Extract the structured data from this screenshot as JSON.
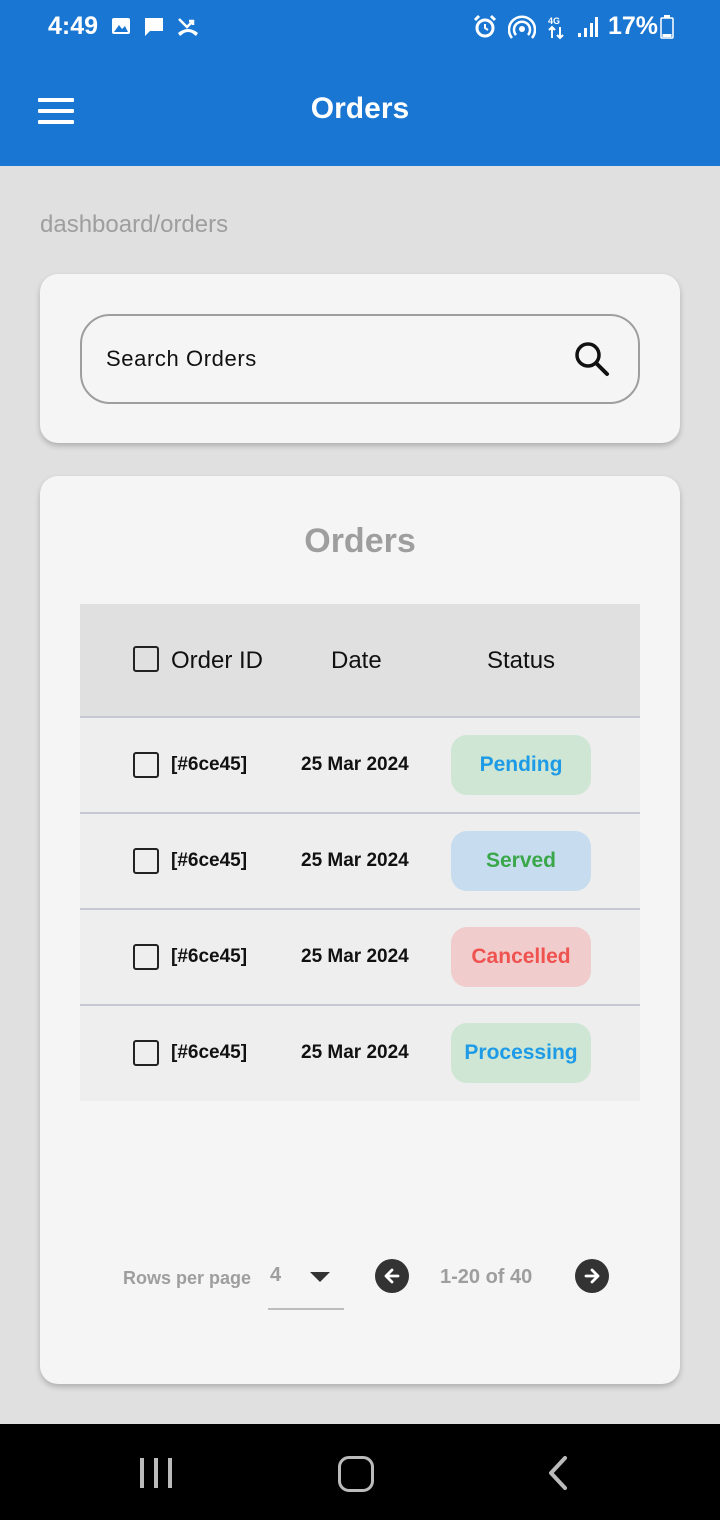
{
  "status_bar": {
    "time": "4:49",
    "left_icons": [
      "image-icon",
      "message-icon",
      "missed-call-icon"
    ],
    "right_icons": [
      "alarm-icon",
      "hotspot-icon",
      "4g-data-icon",
      "signal-icon"
    ],
    "battery": "17%"
  },
  "app_bar": {
    "title": "Orders",
    "menu_icon": "hamburger-menu-icon"
  },
  "breadcrumb": "dashboard/orders",
  "search": {
    "placeholder": "Search Orders",
    "value": "",
    "icon": "search-icon"
  },
  "orders_table": {
    "title": "Orders",
    "columns": [
      "Order ID",
      "Date",
      "Status"
    ],
    "rows": [
      {
        "id": "[#6ce45]",
        "date": "25 Mar 2024",
        "status": "Pending"
      },
      {
        "id": "[#6ce45]",
        "date": "25 Mar 2024",
        "status": "Served"
      },
      {
        "id": "[#6ce45]",
        "date": "25 Mar 2024",
        "status": "Cancelled"
      },
      {
        "id": "[#6ce45]",
        "date": "25 Mar 2024",
        "status": "Processing"
      }
    ],
    "status_colors": {
      "Pending": {
        "text": "#1e9be6",
        "bg": "#cfe6d4"
      },
      "Served": {
        "text": "#3aa84a",
        "bg": "#c7dcef"
      },
      "Cancelled": {
        "text": "#ef5350",
        "bg": "#f1cccc"
      },
      "Processing": {
        "text": "#1e9be6",
        "bg": "#cfe6d4"
      }
    }
  },
  "pagination": {
    "rows_per_page_label": "Rows per page",
    "rows_per_page_value": "4",
    "range_text": "1-20 of 40"
  },
  "colors": {
    "primary": "#1976d2",
    "background": "#e0e0e0",
    "card": "#f5f5f5"
  }
}
